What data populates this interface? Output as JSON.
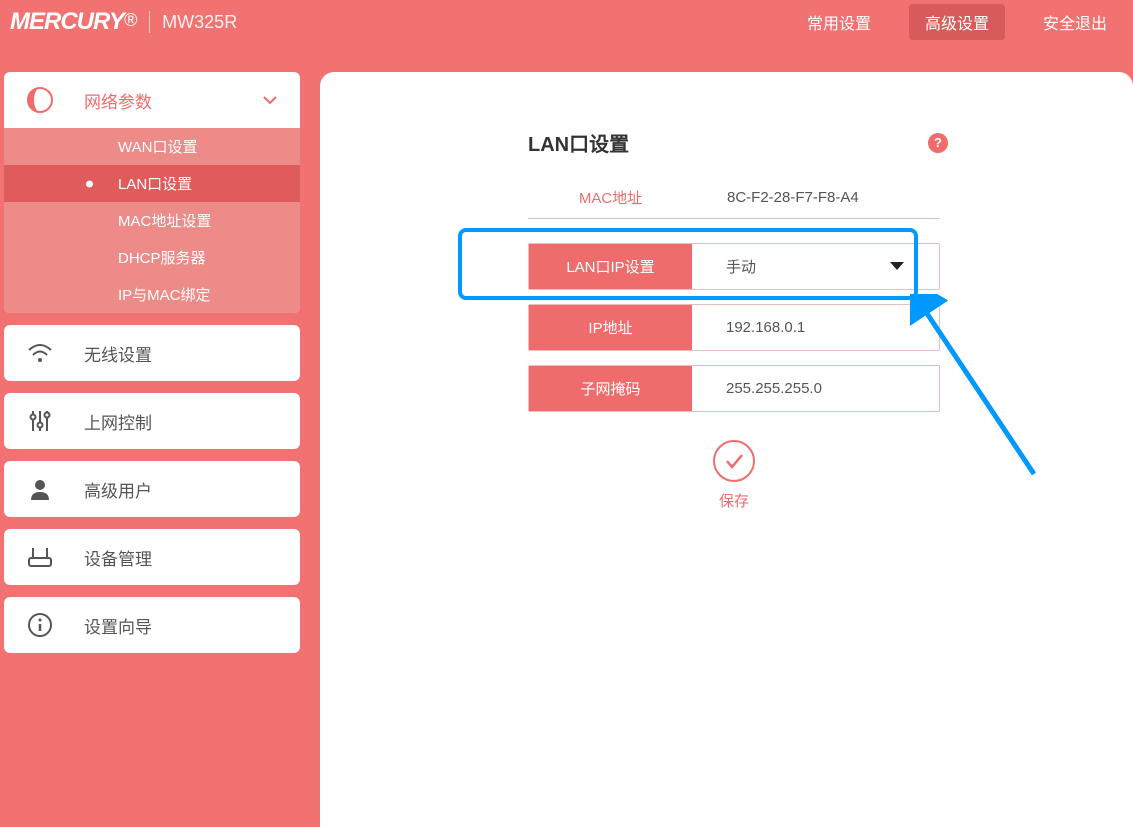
{
  "brand": {
    "logo": "MERCURY",
    "model": "MW325R"
  },
  "topnav": {
    "common": "常用设置",
    "advanced": "高级设置",
    "logout": "安全退出"
  },
  "sidebar": {
    "network": {
      "label": "网络参数",
      "items": [
        "WAN口设置",
        "LAN口设置",
        "MAC地址设置",
        "DHCP服务器",
        "IP与MAC绑定"
      ]
    },
    "wireless": "无线设置",
    "control": "上网控制",
    "users": "高级用户",
    "device": "设备管理",
    "wizard": "设置向导"
  },
  "page": {
    "title": "LAN口设置",
    "mac_label": "MAC地址",
    "mac_value": "8C-F2-28-F7-F8-A4",
    "lan_ip_setting_label": "LAN口IP设置",
    "lan_ip_setting_value": "手动",
    "ip_label": "IP地址",
    "ip_value": "192.168.0.1",
    "mask_label": "子网掩码",
    "mask_value": "255.255.255.0",
    "save": "保存"
  }
}
